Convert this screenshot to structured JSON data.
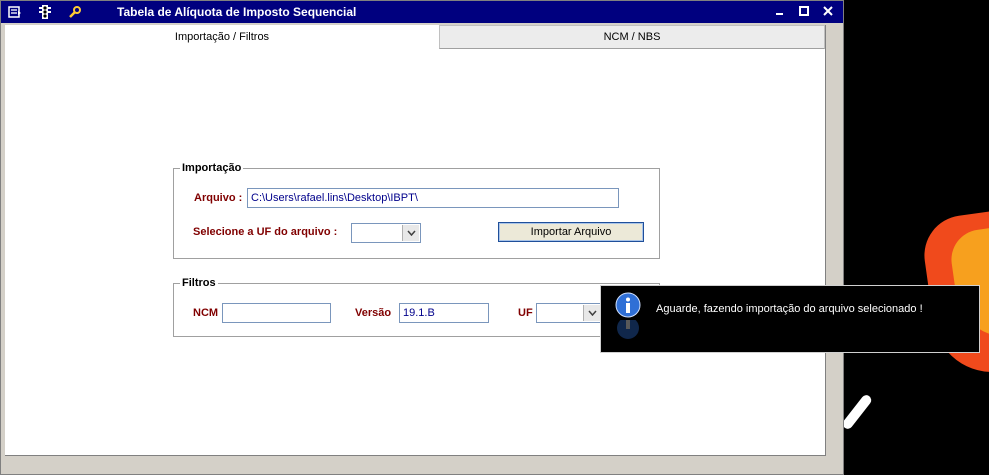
{
  "window": {
    "title": "Tabela de Alíquota de Imposto Sequencial",
    "titlebar_color": "#00007f"
  },
  "tabs": [
    {
      "label": "Importação / Filtros",
      "active": true
    },
    {
      "label": "NCM / NBS",
      "active": false
    }
  ],
  "importacao": {
    "legend": "Importação",
    "arquivo_label": "Arquivo :",
    "arquivo_value": "C:\\Users\\rafael.lins\\Desktop\\IBPT\\",
    "uf_label": "Selecione a UF do arquivo :",
    "uf_value": "",
    "import_button": "Importar Arquivo"
  },
  "filtros": {
    "legend": "Filtros",
    "ncm_label": "NCM",
    "ncm_value": "",
    "versao_label": "Versão",
    "versao_value": "19.1.B",
    "uf_label": "UF",
    "uf_value": ""
  },
  "toast": {
    "message": "Aguarde, fazendo importação do arquivo selecionado !",
    "icon": "info-icon"
  },
  "icons": [
    "menu-icon",
    "traffic-light-icon",
    "wrench-icon",
    "minimize-icon",
    "maximize-icon",
    "close-icon"
  ]
}
